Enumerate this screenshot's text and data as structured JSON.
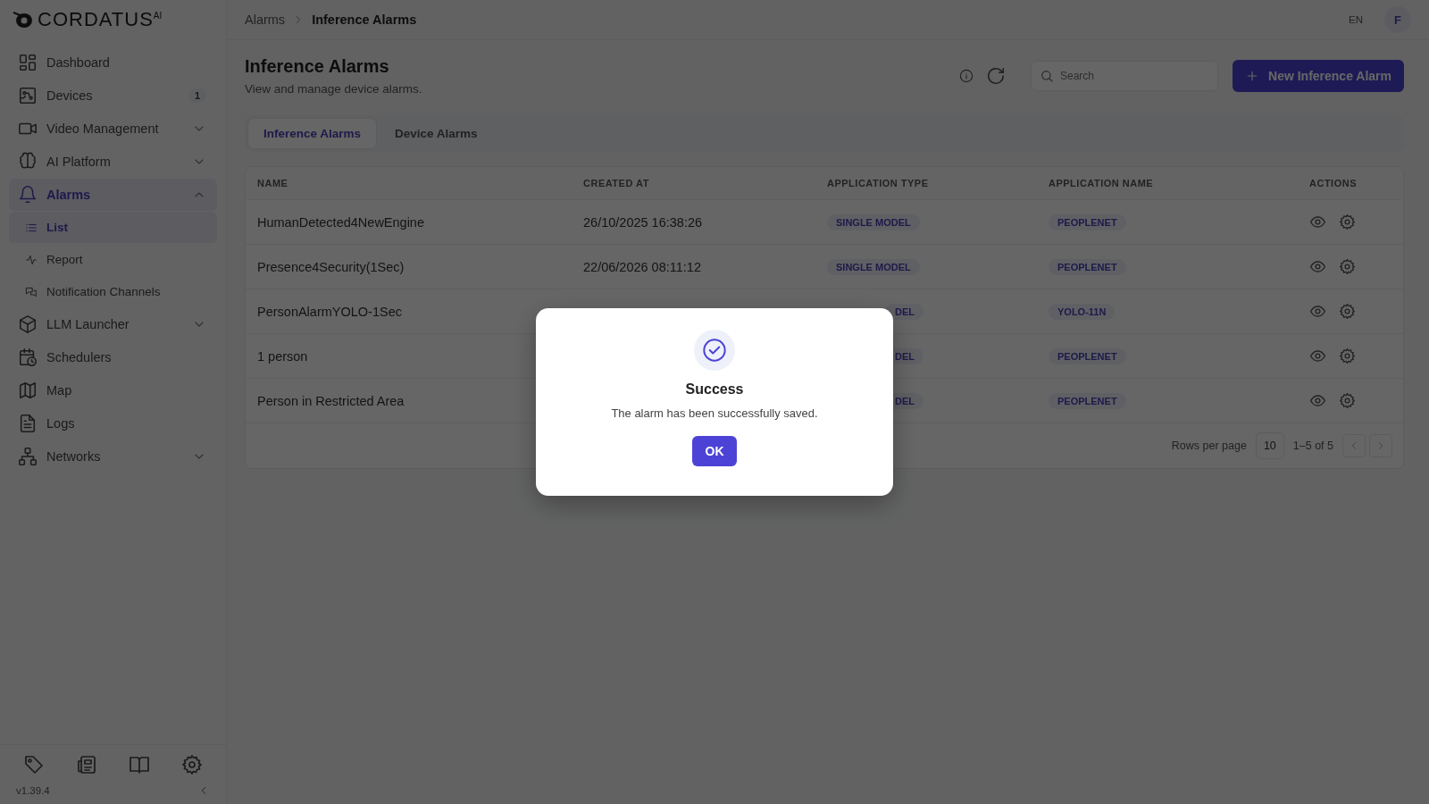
{
  "sidebar": {
    "logo": "CORDATUS",
    "logo_mark": "AI",
    "items": [
      {
        "label": "Dashboard",
        "kind": "dashboard",
        "selected": false
      },
      {
        "label": "Devices",
        "kind": "devices",
        "selected": false,
        "badge": "1"
      },
      {
        "label": "Video Management",
        "kind": "video",
        "selected": false,
        "expanded": false
      },
      {
        "label": "AI Platform",
        "kind": "brain",
        "selected": false,
        "expanded": false
      },
      {
        "label": "Alarms",
        "kind": "bell",
        "selected": true,
        "expanded": true,
        "children": [
          {
            "label": "List",
            "kind": "list",
            "selected": true
          },
          {
            "label": "Report",
            "kind": "pulse",
            "selected": false
          },
          {
            "label": "Notification Channels",
            "kind": "chat",
            "selected": false
          }
        ]
      },
      {
        "label": "LLM Launcher",
        "kind": "box",
        "selected": false,
        "expanded": false
      },
      {
        "label": "Schedulers",
        "kind": "calendar",
        "selected": false
      },
      {
        "label": "Map",
        "kind": "map",
        "selected": false
      },
      {
        "label": "Logs",
        "kind": "file",
        "selected": false
      },
      {
        "label": "Networks",
        "kind": "network",
        "selected": false,
        "expanded": false
      }
    ],
    "version": "v1.39.4"
  },
  "header": {
    "breadcrumb": [
      "Alarms",
      "Inference Alarms"
    ],
    "language": "EN",
    "avatar": "F"
  },
  "page": {
    "title": "Inference Alarms",
    "subtitle": "View and manage device alarms.",
    "search": {
      "placeholder": "Search"
    },
    "new_button": "New Inference Alarm"
  },
  "tabs": [
    {
      "label": "Inference Alarms",
      "selected": true
    },
    {
      "label": "Device Alarms",
      "selected": false
    }
  ],
  "table": {
    "columns": [
      "NAME",
      "CREATED AT",
      "APPLICATION TYPE",
      "APPLICATION NAME",
      "ACTIONS"
    ],
    "rows": [
      {
        "name": "HumanDetected4NewEngine",
        "created_at": "26/10/2025 16:38:26",
        "application_type": "SINGLE MODEL",
        "clipped": false,
        "application_name": "PEOPLENET"
      },
      {
        "name": "Presence4Security(1Sec)",
        "created_at": "22/06/2026 08:11:12",
        "application_type": "SINGLE MODEL",
        "clipped": false,
        "application_name": "PEOPLENET"
      },
      {
        "name": "PersonAlarmYOLO-1Sec",
        "application_type": "DEL",
        "clipped": true,
        "application_name": "YOLO-11N"
      },
      {
        "name": "1 person",
        "application_type": "DEL",
        "clipped": true,
        "application_name": "PEOPLENET"
      },
      {
        "name": "Person in Restricted Area",
        "application_type": "DEL",
        "clipped": true,
        "application_name": "PEOPLENET"
      }
    ],
    "pagination": {
      "rows_per_page_label": "Rows per page",
      "rows_per_page": "10",
      "range": "1–5 of 5"
    }
  },
  "dialog": {
    "title": "Success",
    "message": "The alarm has been successfully saved.",
    "button": "OK"
  }
}
